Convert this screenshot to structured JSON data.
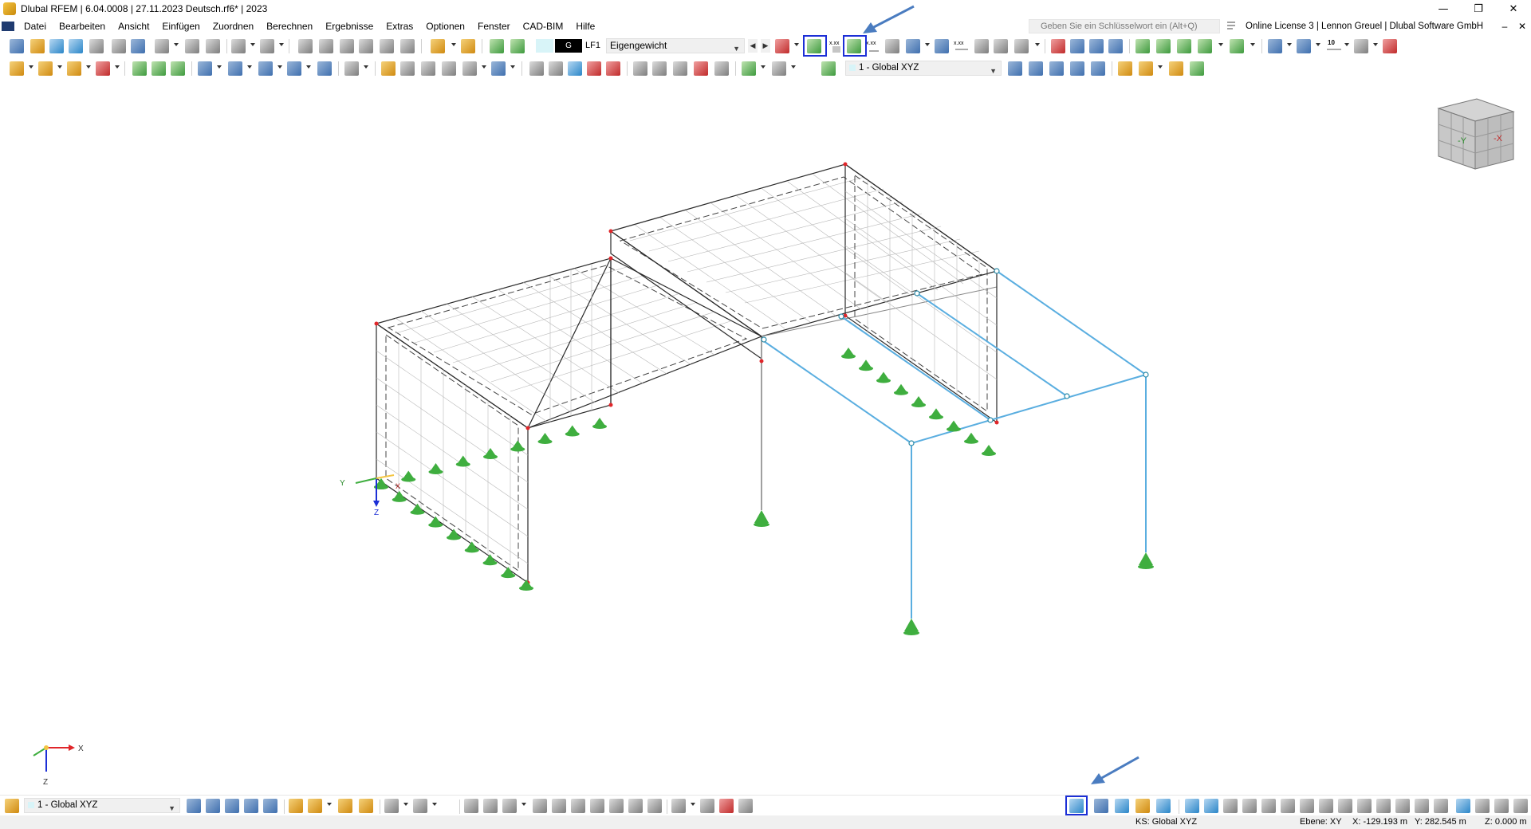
{
  "window": {
    "title": "Dlubal RFEM | 6.04.0008 | 27.11.2023 Deutsch.rf6* | 2023",
    "minimize_icon": "minimize-icon",
    "restore_icon": "restore-icon",
    "close_icon": "close-icon"
  },
  "menubar": {
    "items": [
      "Datei",
      "Bearbeiten",
      "Ansicht",
      "Einfügen",
      "Zuordnen",
      "Berechnen",
      "Ergebnisse",
      "Extras",
      "Optionen",
      "Fenster",
      "CAD-BIM",
      "Hilfe"
    ],
    "search_placeholder": "Geben Sie ein Schlüsselwort ein (Alt+Q)",
    "license": "Online License 3 | Lennon Greuel | Dlubal Software GmbH"
  },
  "toolbar1": {
    "load_case_badge": "G",
    "load_case_code": "LF1",
    "load_case_name": "Eigengewicht",
    "value_label_1": "x.xx",
    "value_label_2": "x.xx",
    "value_label_3": "x.xx",
    "scale_label": "10"
  },
  "toolbar2": {
    "coordinate_system": "1 - Global XYZ"
  },
  "viewport": {
    "axis_labels": {
      "y": "Y",
      "z": "Z",
      "x": "X"
    },
    "corner_axis_labels": {
      "x": "X",
      "z": "Z"
    },
    "view_cube": {
      "front_label": "-Y",
      "side_label": "-X"
    },
    "colors": {
      "surface_edges": "#2a2a2a",
      "grid_lines": "#b8b8b8",
      "members": "#5aaee0",
      "nodes_red": "#e0262a",
      "supports": "#3fae3f",
      "highlight": "#1c2fd6",
      "annotation_arrow": "#4a7cc0"
    }
  },
  "bottombar": {
    "coordinate_system": "1 - Global XYZ"
  },
  "statusbar": {
    "cs": "KS: Global XYZ",
    "plane": "Ebene: XY",
    "x": "X: -129.193 m",
    "y": "Y: 282.545 m",
    "z": "Z: 0.000 m"
  }
}
